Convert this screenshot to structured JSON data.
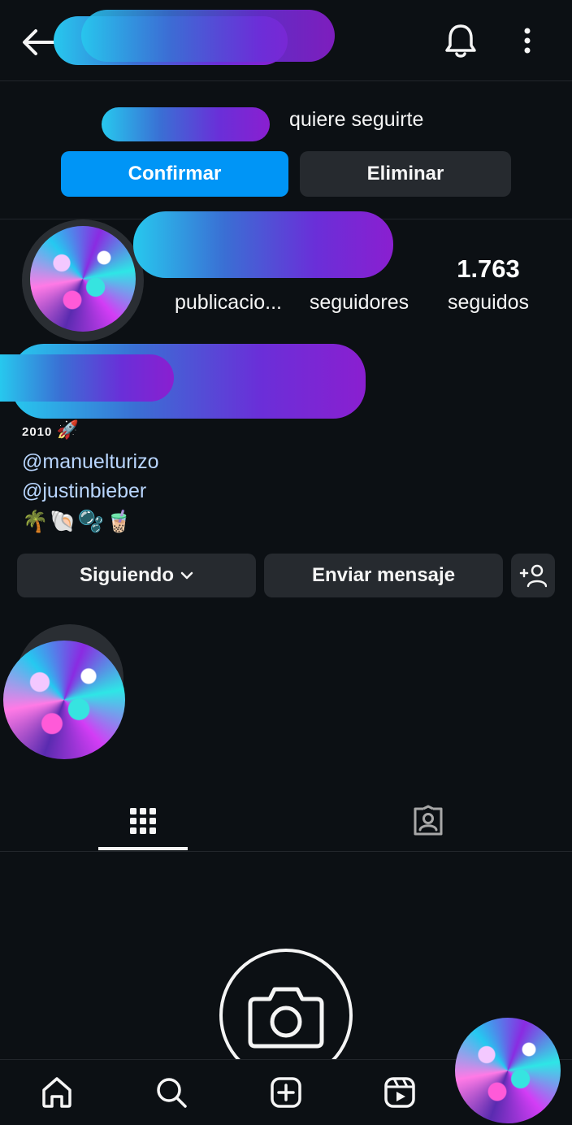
{
  "header": {
    "back_icon": "arrow-left-icon",
    "bell_icon": "bell-icon",
    "more_icon": "more-vertical-icon"
  },
  "follow_request": {
    "text": "quiere seguirte",
    "confirm_label": "Confirmar",
    "remove_label": "Eliminar"
  },
  "profile": {
    "stats": [
      {
        "value": "",
        "label": "publicacio..."
      },
      {
        "value": "",
        "label": "seguidores"
      },
      {
        "value": "1.763",
        "label": "seguidos"
      }
    ],
    "bio": {
      "year": "2010",
      "year_emoji": "🚀",
      "links": [
        "@manuelturizo",
        "@justinbieber"
      ],
      "emojis": "🌴🐚🫧🧋"
    }
  },
  "actions": {
    "following_label": "Siguiendo",
    "message_label": "Enviar mensaje",
    "add_user_icon": "add-user-icon"
  },
  "tabs": [
    {
      "name": "grid",
      "icon": "grid-icon",
      "active": true
    },
    {
      "name": "tagged",
      "icon": "tagged-person-icon",
      "active": false
    }
  ],
  "bottom_nav": [
    {
      "name": "home",
      "icon": "home-icon"
    },
    {
      "name": "search",
      "icon": "search-icon"
    },
    {
      "name": "create",
      "icon": "plus-square-icon"
    },
    {
      "name": "reels",
      "icon": "reels-icon"
    },
    {
      "name": "profile",
      "icon": "profile-avatar"
    }
  ],
  "colors": {
    "background": "#0c1014",
    "primary_button": "#0095f6",
    "secondary_button": "#262a2f",
    "link": "#b9d6ff"
  }
}
